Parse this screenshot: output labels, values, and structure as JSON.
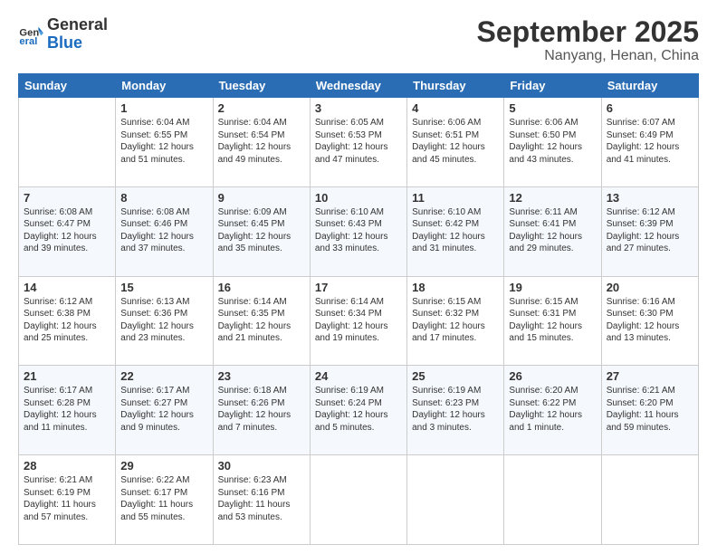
{
  "logo": {
    "text_general": "General",
    "text_blue": "Blue"
  },
  "header": {
    "month": "September 2025",
    "location": "Nanyang, Henan, China"
  },
  "weekdays": [
    "Sunday",
    "Monday",
    "Tuesday",
    "Wednesday",
    "Thursday",
    "Friday",
    "Saturday"
  ],
  "weeks": [
    [
      {
        "day": "",
        "sunrise": "",
        "sunset": "",
        "daylight": ""
      },
      {
        "day": "1",
        "sunrise": "Sunrise: 6:04 AM",
        "sunset": "Sunset: 6:55 PM",
        "daylight": "Daylight: 12 hours and 51 minutes."
      },
      {
        "day": "2",
        "sunrise": "Sunrise: 6:04 AM",
        "sunset": "Sunset: 6:54 PM",
        "daylight": "Daylight: 12 hours and 49 minutes."
      },
      {
        "day": "3",
        "sunrise": "Sunrise: 6:05 AM",
        "sunset": "Sunset: 6:53 PM",
        "daylight": "Daylight: 12 hours and 47 minutes."
      },
      {
        "day": "4",
        "sunrise": "Sunrise: 6:06 AM",
        "sunset": "Sunset: 6:51 PM",
        "daylight": "Daylight: 12 hours and 45 minutes."
      },
      {
        "day": "5",
        "sunrise": "Sunrise: 6:06 AM",
        "sunset": "Sunset: 6:50 PM",
        "daylight": "Daylight: 12 hours and 43 minutes."
      },
      {
        "day": "6",
        "sunrise": "Sunrise: 6:07 AM",
        "sunset": "Sunset: 6:49 PM",
        "daylight": "Daylight: 12 hours and 41 minutes."
      }
    ],
    [
      {
        "day": "7",
        "sunrise": "Sunrise: 6:08 AM",
        "sunset": "Sunset: 6:47 PM",
        "daylight": "Daylight: 12 hours and 39 minutes."
      },
      {
        "day": "8",
        "sunrise": "Sunrise: 6:08 AM",
        "sunset": "Sunset: 6:46 PM",
        "daylight": "Daylight: 12 hours and 37 minutes."
      },
      {
        "day": "9",
        "sunrise": "Sunrise: 6:09 AM",
        "sunset": "Sunset: 6:45 PM",
        "daylight": "Daylight: 12 hours and 35 minutes."
      },
      {
        "day": "10",
        "sunrise": "Sunrise: 6:10 AM",
        "sunset": "Sunset: 6:43 PM",
        "daylight": "Daylight: 12 hours and 33 minutes."
      },
      {
        "day": "11",
        "sunrise": "Sunrise: 6:10 AM",
        "sunset": "Sunset: 6:42 PM",
        "daylight": "Daylight: 12 hours and 31 minutes."
      },
      {
        "day": "12",
        "sunrise": "Sunrise: 6:11 AM",
        "sunset": "Sunset: 6:41 PM",
        "daylight": "Daylight: 12 hours and 29 minutes."
      },
      {
        "day": "13",
        "sunrise": "Sunrise: 6:12 AM",
        "sunset": "Sunset: 6:39 PM",
        "daylight": "Daylight: 12 hours and 27 minutes."
      }
    ],
    [
      {
        "day": "14",
        "sunrise": "Sunrise: 6:12 AM",
        "sunset": "Sunset: 6:38 PM",
        "daylight": "Daylight: 12 hours and 25 minutes."
      },
      {
        "day": "15",
        "sunrise": "Sunrise: 6:13 AM",
        "sunset": "Sunset: 6:36 PM",
        "daylight": "Daylight: 12 hours and 23 minutes."
      },
      {
        "day": "16",
        "sunrise": "Sunrise: 6:14 AM",
        "sunset": "Sunset: 6:35 PM",
        "daylight": "Daylight: 12 hours and 21 minutes."
      },
      {
        "day": "17",
        "sunrise": "Sunrise: 6:14 AM",
        "sunset": "Sunset: 6:34 PM",
        "daylight": "Daylight: 12 hours and 19 minutes."
      },
      {
        "day": "18",
        "sunrise": "Sunrise: 6:15 AM",
        "sunset": "Sunset: 6:32 PM",
        "daylight": "Daylight: 12 hours and 17 minutes."
      },
      {
        "day": "19",
        "sunrise": "Sunrise: 6:15 AM",
        "sunset": "Sunset: 6:31 PM",
        "daylight": "Daylight: 12 hours and 15 minutes."
      },
      {
        "day": "20",
        "sunrise": "Sunrise: 6:16 AM",
        "sunset": "Sunset: 6:30 PM",
        "daylight": "Daylight: 12 hours and 13 minutes."
      }
    ],
    [
      {
        "day": "21",
        "sunrise": "Sunrise: 6:17 AM",
        "sunset": "Sunset: 6:28 PM",
        "daylight": "Daylight: 12 hours and 11 minutes."
      },
      {
        "day": "22",
        "sunrise": "Sunrise: 6:17 AM",
        "sunset": "Sunset: 6:27 PM",
        "daylight": "Daylight: 12 hours and 9 minutes."
      },
      {
        "day": "23",
        "sunrise": "Sunrise: 6:18 AM",
        "sunset": "Sunset: 6:26 PM",
        "daylight": "Daylight: 12 hours and 7 minutes."
      },
      {
        "day": "24",
        "sunrise": "Sunrise: 6:19 AM",
        "sunset": "Sunset: 6:24 PM",
        "daylight": "Daylight: 12 hours and 5 minutes."
      },
      {
        "day": "25",
        "sunrise": "Sunrise: 6:19 AM",
        "sunset": "Sunset: 6:23 PM",
        "daylight": "Daylight: 12 hours and 3 minutes."
      },
      {
        "day": "26",
        "sunrise": "Sunrise: 6:20 AM",
        "sunset": "Sunset: 6:22 PM",
        "daylight": "Daylight: 12 hours and 1 minute."
      },
      {
        "day": "27",
        "sunrise": "Sunrise: 6:21 AM",
        "sunset": "Sunset: 6:20 PM",
        "daylight": "Daylight: 11 hours and 59 minutes."
      }
    ],
    [
      {
        "day": "28",
        "sunrise": "Sunrise: 6:21 AM",
        "sunset": "Sunset: 6:19 PM",
        "daylight": "Daylight: 11 hours and 57 minutes."
      },
      {
        "day": "29",
        "sunrise": "Sunrise: 6:22 AM",
        "sunset": "Sunset: 6:17 PM",
        "daylight": "Daylight: 11 hours and 55 minutes."
      },
      {
        "day": "30",
        "sunrise": "Sunrise: 6:23 AM",
        "sunset": "Sunset: 6:16 PM",
        "daylight": "Daylight: 11 hours and 53 minutes."
      },
      {
        "day": "",
        "sunrise": "",
        "sunset": "",
        "daylight": ""
      },
      {
        "day": "",
        "sunrise": "",
        "sunset": "",
        "daylight": ""
      },
      {
        "day": "",
        "sunrise": "",
        "sunset": "",
        "daylight": ""
      },
      {
        "day": "",
        "sunrise": "",
        "sunset": "",
        "daylight": ""
      }
    ]
  ]
}
